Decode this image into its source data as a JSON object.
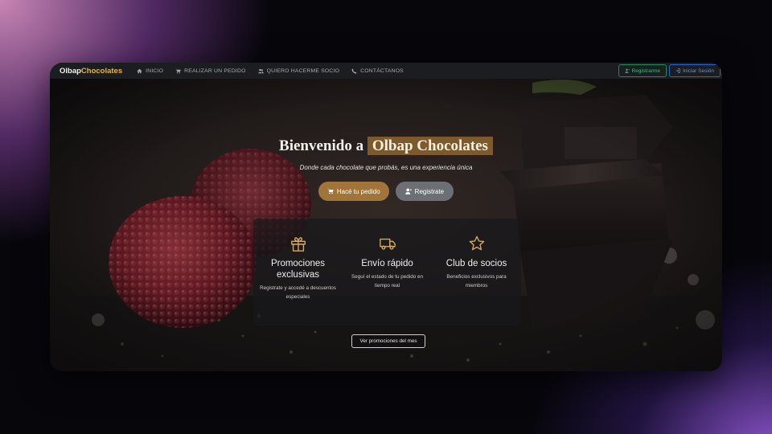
{
  "navbar": {
    "brand_part1": "Olbap",
    "brand_part2": "Chocolates",
    "items": [
      {
        "label": "INICIO",
        "icon": "home-icon"
      },
      {
        "label": "REALIZAR UN PEDIDO",
        "icon": "cart-icon"
      },
      {
        "label": "QUIERO HACERME SOCIO",
        "icon": "users-icon"
      },
      {
        "label": "CONTÁCTANOS",
        "icon": "phone-icon"
      }
    ],
    "register_label": "Registrarme",
    "login_label": "Iniciar Sesión"
  },
  "hero": {
    "title_prefix": "Bienvenido a",
    "title_highlight": "Olbap Chocolates",
    "subtitle": "Donde cada chocolate que probás, es una experiencia única",
    "order_button": "Hacé tu pedido",
    "register_button": "Registrate",
    "features": [
      {
        "icon": "gift-icon",
        "title": "Promociones exclusivas",
        "text": "Registrate y accedé a descuentos especiales"
      },
      {
        "icon": "truck-icon",
        "title": "Envío rápido",
        "text": "Seguí el estado de tu pedido en tiempo real"
      },
      {
        "icon": "star-icon",
        "title": "Club de socios",
        "text": "Beneficios exclusivos para miembros"
      }
    ],
    "promo_button": "Ver promociones del mes"
  },
  "colors": {
    "accent": "#e3b44d",
    "primary_button": "#a17539",
    "secondary_button": "#6c7075",
    "register_outline": "#1f8a5a",
    "login_outline": "#2c63c8"
  }
}
